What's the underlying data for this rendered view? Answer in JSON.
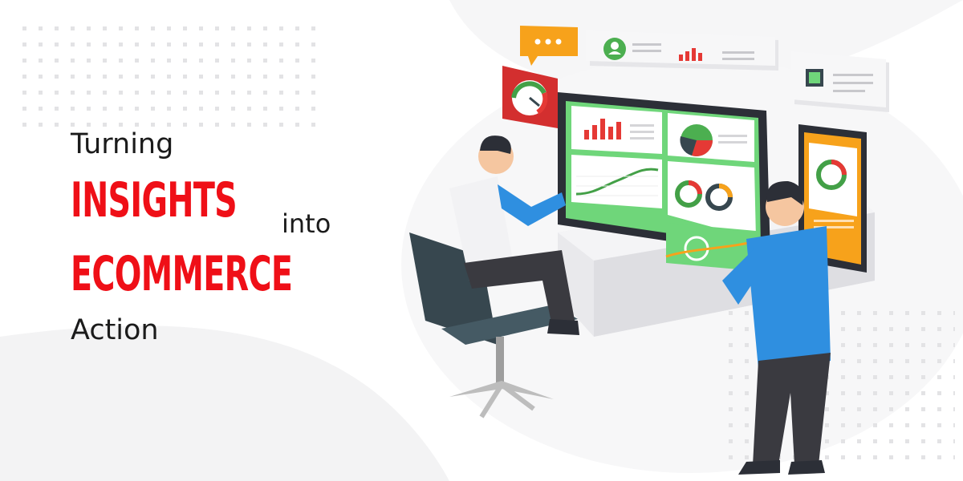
{
  "headline": {
    "line1": "Turning",
    "line2": "INSIGHTS",
    "line2_suffix": "into",
    "line3": "ECOMMERCE",
    "line4": "Action"
  },
  "colors": {
    "accent_red": "#ef0f17",
    "text_dark": "#1b1b1b",
    "screen_green": "#6fd67a",
    "shirt_blue": "#2f8fe0",
    "phone_orange": "#f7a21b"
  },
  "icons": [
    "chat-bubble-icon",
    "user-profile-icon",
    "bar-chart-icon",
    "pie-chart-icon",
    "donut-chart-icon",
    "line-graph-icon",
    "gauge-icon"
  ]
}
